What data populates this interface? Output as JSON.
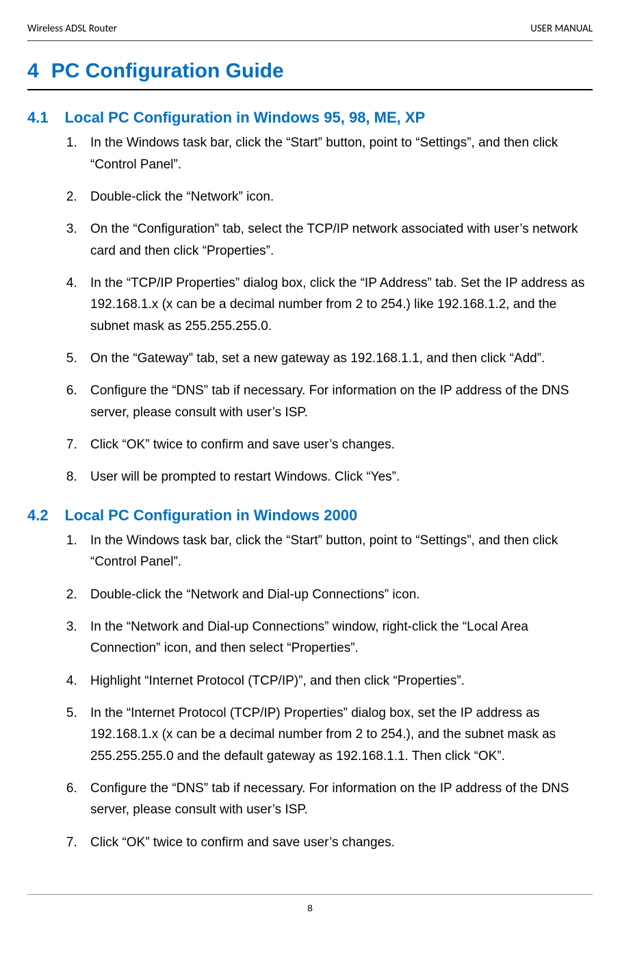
{
  "header": {
    "left": "Wireless ADSL Router",
    "right": "USER MANUAL"
  },
  "chapter": {
    "number": "4",
    "title": "PC Configuration Guide"
  },
  "section1": {
    "number": "4.1",
    "title": "Local PC Configuration in Windows 95, 98, ME, XP",
    "steps": [
      "In the Windows task bar, click the “Start” button, point to “Settings”, and then click “Control Panel”.",
      "Double-click the “Network” icon.",
      "On the “Configuration” tab, select the TCP/IP network associated with user’s network card and then click “Properties”.",
      "In the “TCP/IP Properties” dialog box, click the “IP Address” tab. Set the IP address as 192.168.1.x (x can be a decimal number from 2 to 254.) like 192.168.1.2, and the subnet mask as 255.255.255.0.",
      "On the “Gateway” tab, set a new gateway as 192.168.1.1, and then click “Add”.",
      "Configure the “DNS” tab if necessary. For information on the IP address of the DNS server, please consult with user’s ISP.",
      "Click “OK” twice to confirm and save user’s changes.",
      "User will be prompted to restart Windows. Click “Yes”."
    ]
  },
  "section2": {
    "number": "4.2",
    "title": "Local PC Configuration in Windows 2000",
    "steps": [
      "In the Windows task bar, click the “Start” button, point to “Settings”, and then click “Control Panel”.",
      "Double-click the “Network and Dial-up Connections” icon.",
      "In the “Network and Dial-up Connections” window, right-click the “Local Area Connection” icon, and then select “Properties”.",
      "Highlight “Internet Protocol (TCP/IP)”, and then click “Properties”.",
      "In the “Internet Protocol (TCP/IP) Properties” dialog box, set the IP address as 192.168.1.x (x can be a decimal number from 2 to 254.), and the subnet mask as 255.255.255.0 and the default gateway as 192.168.1.1. Then click “OK”.",
      "Configure the “DNS” tab if necessary. For information on the IP address of the DNS server, please consult with user’s ISP.",
      "Click “OK” twice to confirm and save user’s changes."
    ]
  },
  "page_number": "8"
}
